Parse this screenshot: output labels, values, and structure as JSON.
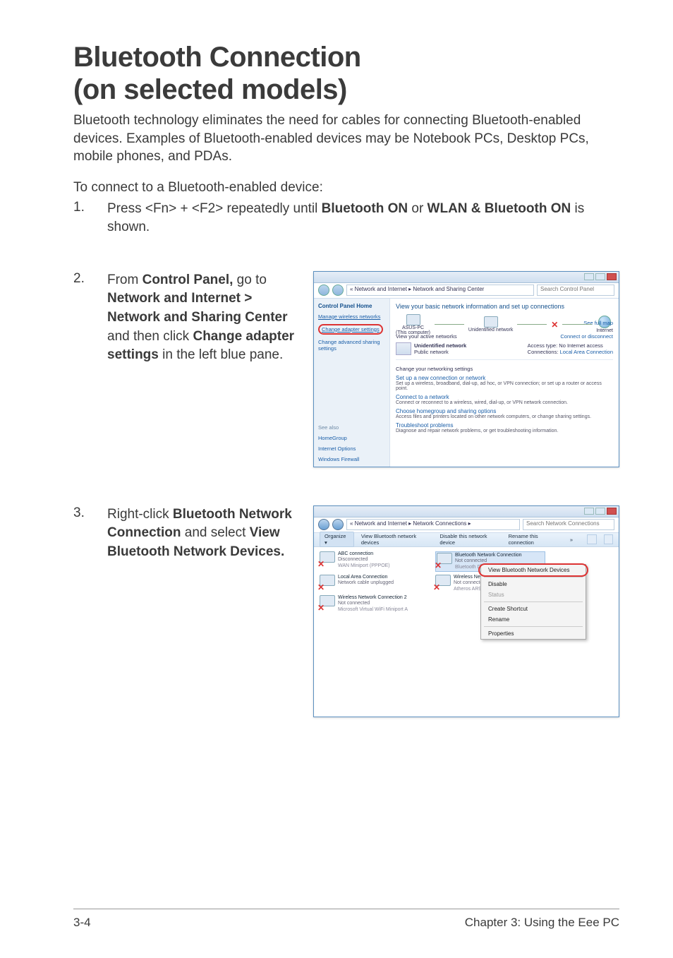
{
  "title_line1": "Bluetooth Connection",
  "title_line2": "(on selected models)",
  "intro": "Bluetooth technology eliminates the need for cables for connecting Bluetooth-enabled devices. Examples of Bluetooth-enabled devices may be Notebook PCs, Desktop PCs, mobile phones, and PDAs.",
  "lead": "To connect to a Bluetooth-enabled device:",
  "step1": {
    "num": "1.",
    "pre": "Press <Fn> + <F2> repeatedly until ",
    "b1": "Bluetooth ON",
    "mid": " or ",
    "b2": "WLAN & Bluetooth ON",
    "post": " is shown."
  },
  "step2": {
    "num": "2.",
    "t1": "From ",
    "b1": "Control Panel,",
    "t2": " go to ",
    "b2": "Network and Internet > Network and Sharing Center",
    "t3": " and then click ",
    "b3": "Change adapter settings",
    "t4": " in the left blue pane."
  },
  "step3": {
    "num": "3.",
    "t1": "Right-click ",
    "b1": "Bluetooth Network Connection",
    "t2": " and select ",
    "b2": "View Bluetooth Network Devices.",
    "t3": ""
  },
  "shot1": {
    "addr": "« Network and Internet ▸ Network and Sharing Center",
    "search": "Search Control Panel",
    "side": {
      "home": "Control Panel Home",
      "l1": "Manage wireless networks",
      "l2": "Change adapter settings",
      "l3": "Change advanced sharing settings",
      "seealso": "See also",
      "s1": "HomeGroup",
      "s2": "Internet Options",
      "s3": "Windows Firewall"
    },
    "main": {
      "title": "View your basic network information and set up connections",
      "fullmap": "See full map",
      "node1a": "ASUS-PC",
      "node1b": "(This computer)",
      "node2": "Unidentified network",
      "node3": "Internet",
      "active": "View your active networks",
      "condis": "Connect or disconnect",
      "net_name": "Unidentified network",
      "net_type": "Public network",
      "p1k": "Access type:",
      "p1v": "No Internet access",
      "p2k": "Connections:",
      "p2v": "Local Area Connection",
      "chg": "Change your networking settings",
      "i1h": "Set up a new connection or network",
      "i1d": "Set up a wireless, broadband, dial-up, ad hoc, or VPN connection; or set up a router or access point.",
      "i2h": "Connect to a network",
      "i2d": "Connect or reconnect to a wireless, wired, dial-up, or VPN network connection.",
      "i3h": "Choose homegroup and sharing options",
      "i3d": "Access files and printers located on other network computers, or change sharing settings.",
      "i4h": "Troubleshoot problems",
      "i4d": "Diagnose and repair network problems, or get troubleshooting information."
    }
  },
  "shot2": {
    "addr": "« Network and Internet ▸ Network Connections ▸",
    "search": "Search Network Connections",
    "toolbar": {
      "org": "Organize ▾",
      "t1": "View Bluetooth network devices",
      "t2": "Disable this network device",
      "t3": "Rename this connection",
      "more": "»"
    },
    "conns": [
      {
        "name": "ABC connection",
        "status": "Disconnected",
        "dev": "WAN Miniport (PPPOE)"
      },
      {
        "name": "Bluetooth Network Connection",
        "status": "Not connected",
        "dev": "Bluetooth Device (Personal Area …"
      },
      {
        "name": "Local Area Connection",
        "status": "Network cable unplugged",
        "dev": ""
      },
      {
        "name": "Wireless Network Connection",
        "status": "Not connected",
        "dev": "Atheros AR9285 Wireless Network…"
      },
      {
        "name": "Wireless Network Connection 2",
        "status": "Not connected",
        "dev": "Microsoft Virtual WiFi Miniport A"
      }
    ],
    "menu": {
      "m1": "View Bluetooth Network Devices",
      "m2": "Disable",
      "m3": "Status",
      "m4": "Create Shortcut",
      "m5": "Rename",
      "m6": "Properties"
    }
  },
  "footer": {
    "left": "3-4",
    "right": "Chapter 3:  Using the Eee PC"
  }
}
